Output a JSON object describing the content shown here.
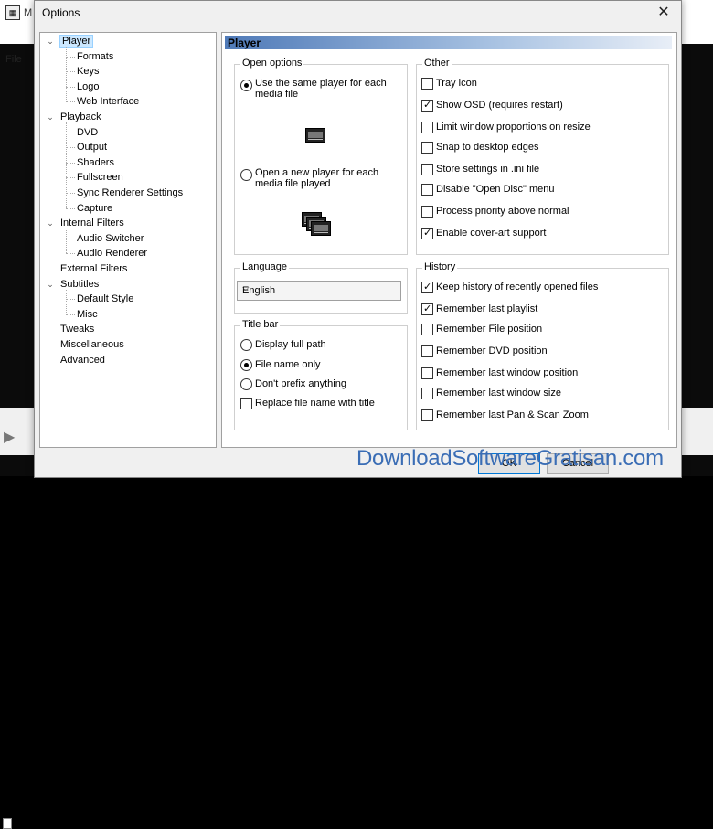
{
  "background_app": {
    "title": "M",
    "menu_file": "File"
  },
  "dialog": {
    "title": "Options",
    "close_glyph": "✕"
  },
  "tree": {
    "items": [
      {
        "label": "Player",
        "level": 0,
        "expanded": true,
        "selected": true
      },
      {
        "label": "Formats",
        "level": 1
      },
      {
        "label": "Keys",
        "level": 1
      },
      {
        "label": "Logo",
        "level": 1
      },
      {
        "label": "Web Interface",
        "level": 1
      },
      {
        "label": "Playback",
        "level": 0,
        "expanded": true
      },
      {
        "label": "DVD",
        "level": 1
      },
      {
        "label": "Output",
        "level": 1
      },
      {
        "label": "Shaders",
        "level": 1
      },
      {
        "label": "Fullscreen",
        "level": 1
      },
      {
        "label": "Sync Renderer Settings",
        "level": 1
      },
      {
        "label": "Capture",
        "level": 1
      },
      {
        "label": "Internal Filters",
        "level": 0,
        "expanded": true
      },
      {
        "label": "Audio Switcher",
        "level": 1
      },
      {
        "label": "Audio Renderer",
        "level": 1
      },
      {
        "label": "External Filters",
        "level": 0
      },
      {
        "label": "Subtitles",
        "level": 0,
        "expanded": true
      },
      {
        "label": "Default Style",
        "level": 1
      },
      {
        "label": "Misc",
        "level": 1
      },
      {
        "label": "Tweaks",
        "level": 0
      },
      {
        "label": "Miscellaneous",
        "level": 0
      },
      {
        "label": "Advanced",
        "level": 0
      }
    ]
  },
  "page": {
    "title": "Player",
    "open_options": {
      "title": "Open options",
      "same_player": "Use the same player for each media file",
      "new_player": "Open a new player for each media file played",
      "selected": "same_player"
    },
    "other": {
      "title": "Other",
      "tray_icon": {
        "label": "Tray icon",
        "checked": false
      },
      "show_osd": {
        "label": "Show OSD (requires restart)",
        "checked": true
      },
      "limit_window": {
        "label": "Limit window proportions on resize",
        "checked": false
      },
      "snap_edges": {
        "label": "Snap to desktop edges",
        "checked": false
      },
      "store_ini": {
        "label": "Store settings in .ini file",
        "checked": false
      },
      "disable_open_disc": {
        "label": "Disable \"Open Disc\" menu",
        "checked": false
      },
      "process_priority": {
        "label": "Process priority above normal",
        "checked": false
      },
      "cover_art": {
        "label": "Enable cover-art support",
        "checked": true
      }
    },
    "language": {
      "title": "Language",
      "selected": "English"
    },
    "title_bar": {
      "title": "Title bar",
      "full_path": "Display full path",
      "file_name_only": "File name only",
      "dont_prefix": "Don't prefix anything",
      "replace_file_name": {
        "label": "Replace file name with title",
        "checked": false
      },
      "selected": "file_name_only"
    },
    "history": {
      "title": "History",
      "keep_history": {
        "label": "Keep history of recently opened files",
        "checked": true
      },
      "last_playlist": {
        "label": "Remember last playlist",
        "checked": true
      },
      "file_position": {
        "label": "Remember File position",
        "checked": false
      },
      "dvd_position": {
        "label": "Remember DVD position",
        "checked": false
      },
      "window_position": {
        "label": "Remember last window position",
        "checked": false
      },
      "window_size": {
        "label": "Remember last window size",
        "checked": false
      },
      "pan_scan": {
        "label": "Remember last Pan & Scan Zoom",
        "checked": false
      }
    }
  },
  "buttons": {
    "ok": "OK",
    "cancel": "Cancel"
  },
  "watermark": "DownloadSoftwareGratisan.com"
}
